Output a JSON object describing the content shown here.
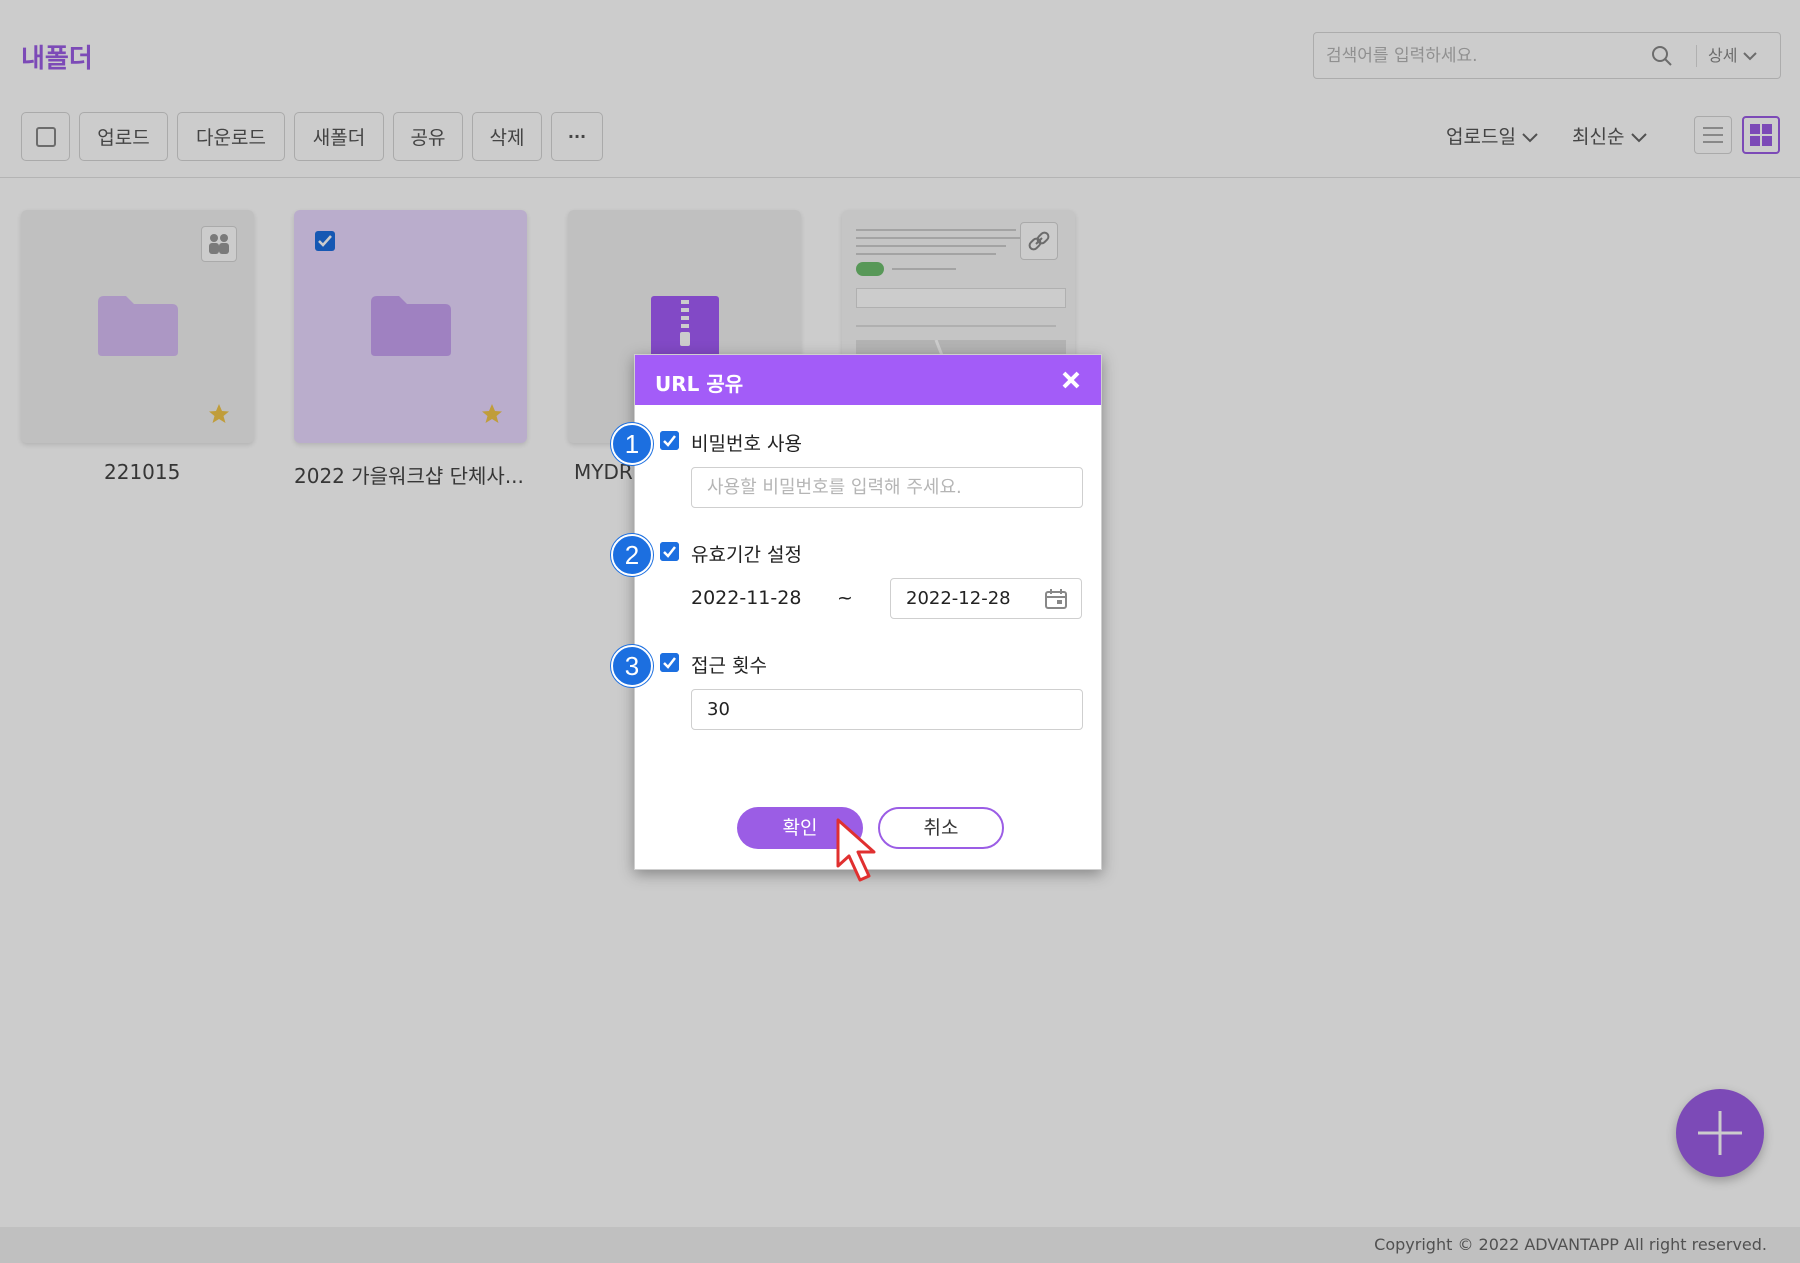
{
  "page": {
    "title": "내폴더",
    "search": {
      "placeholder": "검색어를 입력하세요.",
      "detail_label": "상세"
    },
    "toolbar": {
      "upload": "업로드",
      "download": "다운로드",
      "new_folder": "새폴더",
      "share": "공유",
      "delete": "삭제",
      "more": "···"
    },
    "sort": {
      "field": "업로드일",
      "order": "최신순"
    },
    "items": [
      {
        "name": "221015",
        "type": "folder",
        "shared": true,
        "starred": true,
        "selected": false
      },
      {
        "name": "2022 가을워크샵 단체사...",
        "type": "folder",
        "shared": false,
        "starred": true,
        "selected": true
      },
      {
        "name": "MYDRI",
        "type": "zip",
        "selected": false
      },
      {
        "name": "",
        "type": "image",
        "linked": true,
        "selected": false
      }
    ],
    "footer": {
      "copyright": "Copyright © 2022 ADVANTAPP All right reserved."
    }
  },
  "modal": {
    "title": "URL 공유",
    "options": [
      {
        "step": "1",
        "label": "비밀번호 사용",
        "checked": true,
        "input_placeholder": "사용할 비밀번호를 입력해 주세요.",
        "input_value": ""
      },
      {
        "step": "2",
        "label": "유효기간 설정",
        "checked": true,
        "start_date": "2022-11-28",
        "separator": "~",
        "end_date": "2022-12-28"
      },
      {
        "step": "3",
        "label": "접근 횟수",
        "checked": true,
        "input_value": "30"
      }
    ],
    "confirm_label": "확인",
    "cancel_label": "취소"
  },
  "colors": {
    "brand_purple": "#9b5de5",
    "header_purple": "#a35cf8",
    "step_blue": "#1c6fe0",
    "star": "#f0c54a"
  }
}
